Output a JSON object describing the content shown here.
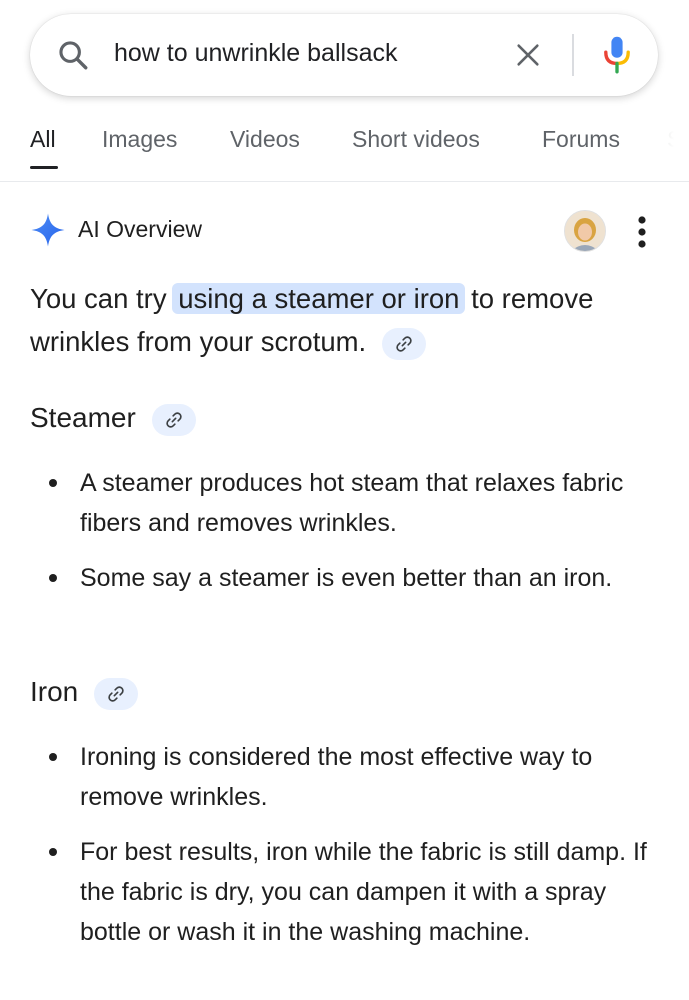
{
  "search": {
    "query": "how to unwrinkle ballsack"
  },
  "tabs": [
    {
      "label": "All",
      "active": true
    },
    {
      "label": "Images"
    },
    {
      "label": "Videos"
    },
    {
      "label": "Short videos"
    },
    {
      "label": "Forums"
    },
    {
      "label": "S"
    }
  ],
  "ai_overview": {
    "title": "AI Overview",
    "summary_before": "You can try ",
    "summary_highlight": "using a steamer or iron",
    "summary_after": " to remove wrinkles from your scrotum.",
    "sections": [
      {
        "heading": "Steamer",
        "bullets": [
          "A steamer produces hot steam that relaxes fabric fibers and removes wrinkles.",
          "Some say a steamer is even better than an iron."
        ]
      },
      {
        "heading": "Iron",
        "bullets": [
          "Ironing is considered the most effective way to remove wrinkles.",
          "For best results, iron while the fabric is still damp. If the fabric is dry, you can dampen it with a spray bottle or wash it in the washing machine."
        ]
      }
    ]
  },
  "icons": {
    "search": "search-icon",
    "clear": "close-icon",
    "mic": "mic-icon",
    "sparkle": "gemini-sparkle-icon",
    "more": "more-vert-icon",
    "link": "link-icon"
  },
  "colors": {
    "highlight": "#d3e3fd",
    "chip": "#e8f0fe",
    "blue": "#4285f4",
    "red": "#ea4335",
    "yellow": "#fbbc04",
    "green": "#34a853"
  }
}
